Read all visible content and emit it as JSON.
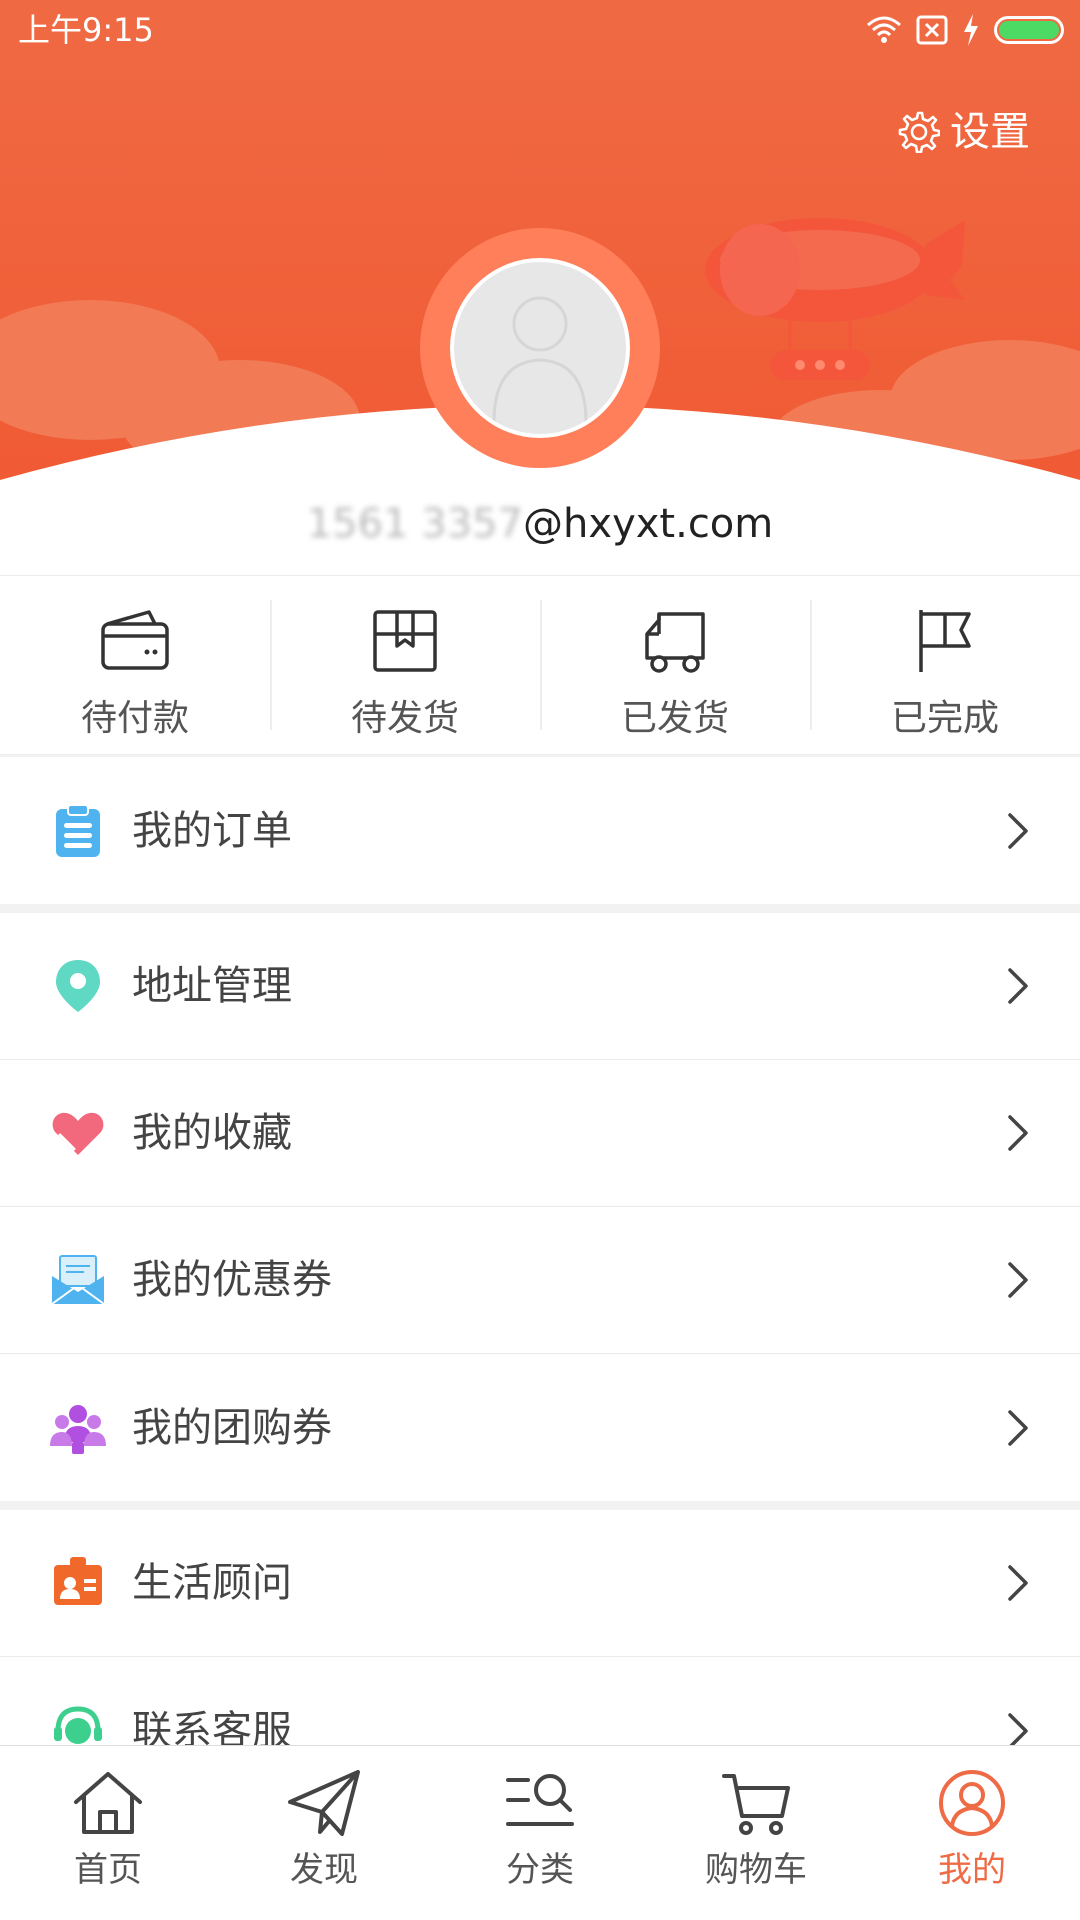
{
  "status_bar": {
    "time": "上午9:15"
  },
  "header": {
    "settings_label": "设置",
    "email_masked": "1561   3357",
    "email_domain": "@hxyxt.com"
  },
  "order_status": [
    {
      "label": "待付款",
      "icon": "wallet-icon"
    },
    {
      "label": "待发货",
      "icon": "package-icon"
    },
    {
      "label": "已发货",
      "icon": "truck-icon"
    },
    {
      "label": "已完成",
      "icon": "flag-icon"
    }
  ],
  "menu": {
    "orders": {
      "label": "我的订单",
      "icon": "clipboard-icon"
    },
    "address": {
      "label": "地址管理",
      "icon": "location-pin-icon"
    },
    "favorites": {
      "label": "我的收藏",
      "icon": "heart-icon"
    },
    "coupons": {
      "label": "我的优惠券",
      "icon": "envelope-icon"
    },
    "group_coupons": {
      "label": "我的团购券",
      "icon": "group-icon"
    },
    "advisor": {
      "label": "生活顾问",
      "icon": "id-badge-icon"
    },
    "support": {
      "label": "联系客服",
      "icon": "headset-icon"
    }
  },
  "tabs": [
    {
      "label": "首页",
      "icon": "home-icon",
      "active": false
    },
    {
      "label": "发现",
      "icon": "paper-plane-icon",
      "active": false
    },
    {
      "label": "分类",
      "icon": "category-search-icon",
      "active": false
    },
    {
      "label": "购物车",
      "icon": "cart-icon",
      "active": false
    },
    {
      "label": "我的",
      "icon": "user-icon",
      "active": true
    }
  ],
  "colors": {
    "brand": "#ee6b45",
    "header_top": "#ef6a43",
    "header_bottom": "#f0552f",
    "active_tab": "#ee6b45"
  }
}
